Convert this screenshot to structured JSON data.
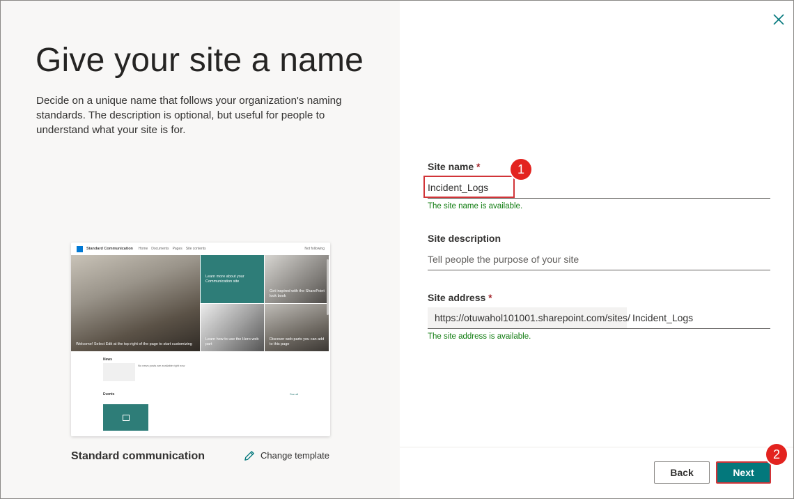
{
  "left": {
    "heading": "Give your site a name",
    "description": "Decide on a unique name that follows your organization's naming standards. The description is optional, but useful for people to understand what your site is for.",
    "template_name": "Standard communication",
    "change_template_label": "Change template",
    "preview": {
      "site_title": "Standard Communication",
      "nav": [
        "Home",
        "Documents",
        "Pages",
        "Site contents"
      ],
      "follow": "Not following",
      "hero_tiles": [
        "Welcome! Select Edit at the top right of the page to start customizing",
        "Learn more about your Communication site",
        "Get inspired with the SharePoint look book",
        "Learn how to use the Hero web part",
        "Discover web parts you can add to this page"
      ],
      "news_heading": "News",
      "news_text": "No news posts are available right now",
      "events_heading": "Events",
      "see_all": "See all"
    }
  },
  "form": {
    "site_name": {
      "label": "Site name",
      "required": "*",
      "value": "Incident_Logs",
      "status": "The site name is available."
    },
    "site_description": {
      "label": "Site description",
      "placeholder": "Tell people the purpose of your site",
      "value": ""
    },
    "site_address": {
      "label": "Site address",
      "required": "*",
      "prefix": "https://otuwahol101001.sharepoint.com/sites/",
      "value": "Incident_Logs",
      "status": "The site address is available."
    }
  },
  "footer": {
    "back_label": "Back",
    "next_label": "Next"
  },
  "annotations": {
    "marker_1": "1",
    "marker_2": "2"
  },
  "colors": {
    "accent": "#03787c",
    "success": "#107c10",
    "highlight": "#d13438"
  }
}
